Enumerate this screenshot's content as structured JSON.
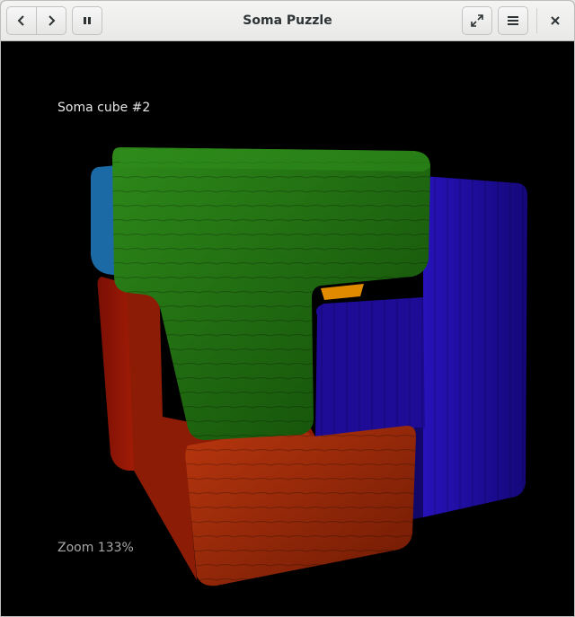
{
  "window": {
    "title": "Soma Puzzle"
  },
  "headerbar": {
    "back_icon": "chevron-left-icon",
    "forward_icon": "chevron-right-icon",
    "pause_icon": "pause-icon",
    "fullscreen_icon": "fullscreen-icon",
    "menu_icon": "hamburger-menu-icon",
    "close_icon": "close-icon"
  },
  "viewport": {
    "puzzle_name": "Soma cube #2",
    "zoom_label": "Zoom 133%",
    "background": "#000000"
  },
  "pieces": [
    {
      "name": "green",
      "color": "#1f6b12"
    },
    {
      "name": "blue",
      "color": "#1c0a9e"
    },
    {
      "name": "red",
      "color": "#a02a08"
    },
    {
      "name": "light-blue",
      "color": "#1b6aa6"
    },
    {
      "name": "orange",
      "color": "#e08a00"
    }
  ]
}
